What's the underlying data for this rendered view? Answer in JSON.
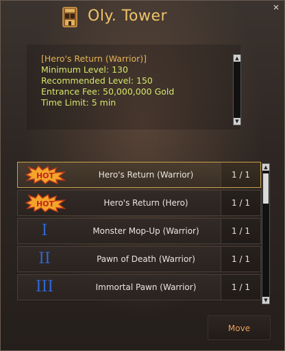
{
  "window": {
    "title": "Oly. Tower",
    "close_glyph": "✕"
  },
  "info": {
    "heading": "[Hero's Return (Warrior)]",
    "lines": [
      "Minimum Level: 130",
      "Recommended Level: 150",
      "Entrance Fee: 50,000,000 Gold",
      "Time Limit: 5 min"
    ]
  },
  "list": {
    "rows": [
      {
        "badge": "HOT",
        "name": "Hero's Return (Warrior)",
        "count": "1 / 1",
        "selected": true
      },
      {
        "badge": "HOT",
        "name": "Hero's Return (Hero)",
        "count": "1 / 1",
        "selected": false
      },
      {
        "badge": "I",
        "name": "Monster Mop-Up (Warrior)",
        "count": "1 / 1",
        "selected": false
      },
      {
        "badge": "II",
        "name": "Pawn of Death (Warrior)",
        "count": "1 / 1",
        "selected": false
      },
      {
        "badge": "III",
        "name": "Immortal Pawn (Warrior)",
        "count": "1 / 1",
        "selected": false
      }
    ]
  },
  "footer": {
    "move_label": "Move"
  },
  "icons": {
    "tower": "tower-icon",
    "hot": "hot-badge-icon",
    "close": "close-icon",
    "scroll_up": "scroll-up-arrow-icon",
    "scroll_down": "scroll-down-arrow-icon"
  },
  "colors": {
    "title": "#f0c36a",
    "info_heading": "#e6b455",
    "info_text": "#d6e86a",
    "roman": "#2f68d8",
    "move": "#e8a060",
    "selected_border": "#c9a24a"
  }
}
